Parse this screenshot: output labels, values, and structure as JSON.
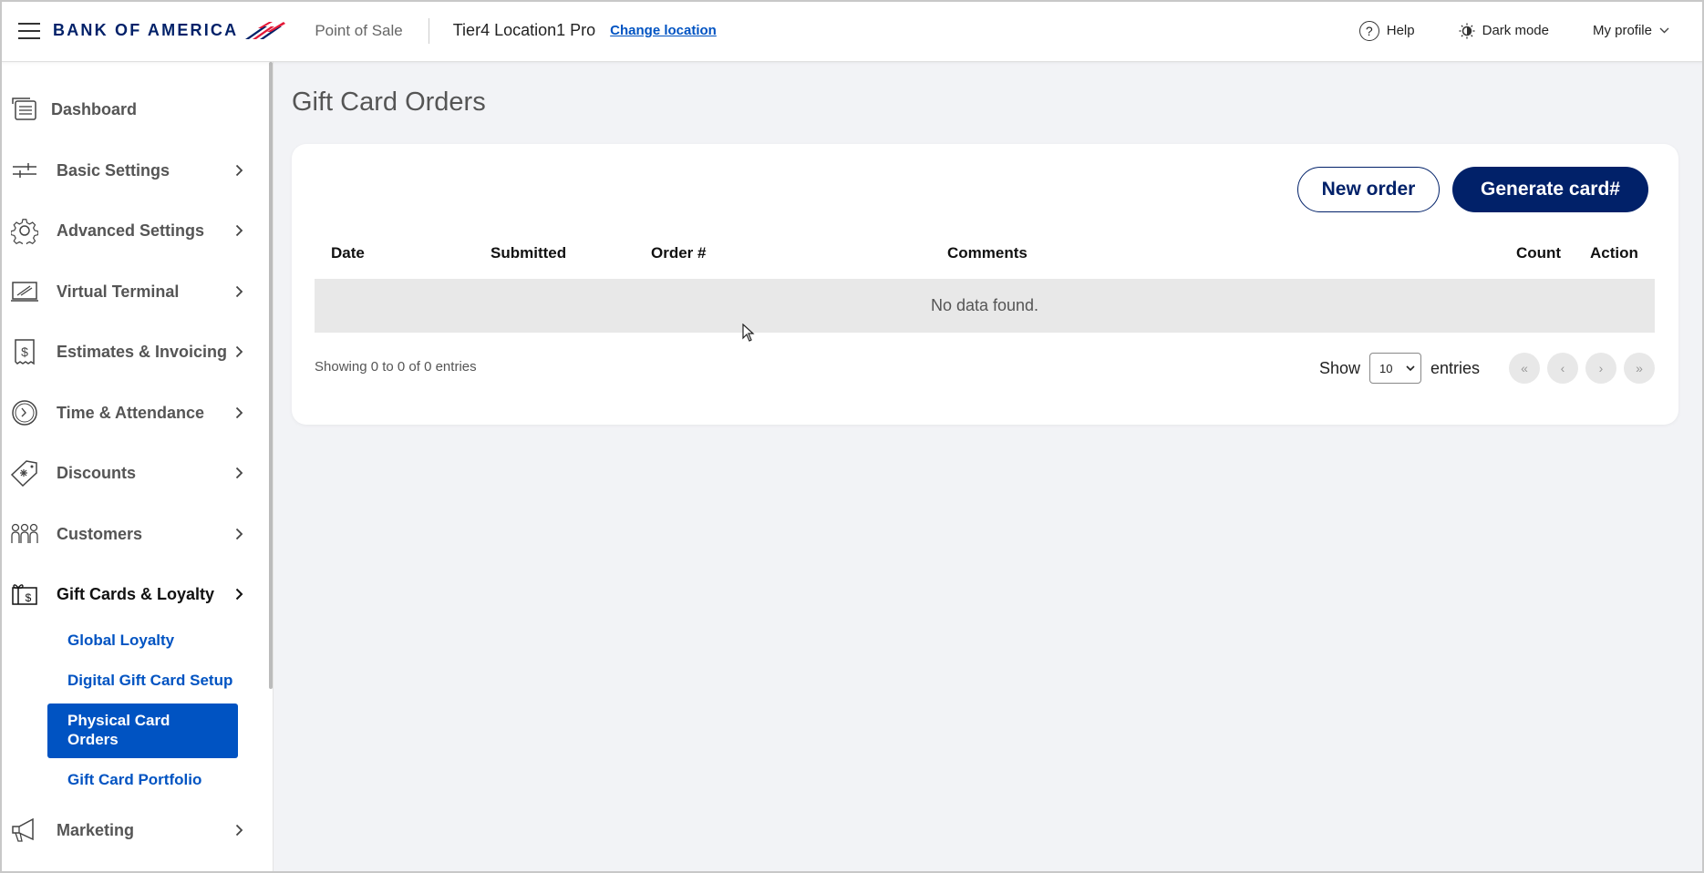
{
  "header": {
    "brand": "BANK OF AMERICA",
    "app_name": "Point of Sale",
    "location_name": "Tier4 Location1 Pro",
    "change_location": "Change location",
    "help": "Help",
    "dark_mode": "Dark mode",
    "my_profile": "My profile"
  },
  "sidebar": {
    "items": [
      {
        "label": "Dashboard",
        "icon": "dashboard-icon"
      },
      {
        "label": "Basic Settings",
        "icon": "sliders-icon"
      },
      {
        "label": "Advanced Settings",
        "icon": "gear-icon"
      },
      {
        "label": "Virtual Terminal",
        "icon": "terminal-icon"
      },
      {
        "label": "Estimates & Invoicing",
        "icon": "invoice-icon"
      },
      {
        "label": "Time & Attendance",
        "icon": "clock-icon"
      },
      {
        "label": "Discounts",
        "icon": "tag-icon"
      },
      {
        "label": "Customers",
        "icon": "people-icon"
      },
      {
        "label": "Gift Cards & Loyalty",
        "icon": "gift-card-icon"
      },
      {
        "label": "Marketing",
        "icon": "megaphone-icon"
      }
    ],
    "sub_items": [
      {
        "label": "Global Loyalty"
      },
      {
        "label": "Digital Gift Card Setup"
      },
      {
        "label": "Physical Card Orders"
      },
      {
        "label": "Gift Card Portfolio"
      }
    ]
  },
  "main": {
    "title": "Gift Card Orders",
    "new_order": "New order",
    "generate_card": "Generate card#",
    "columns": [
      "Date",
      "Submitted",
      "Order #",
      "Comments",
      "Count",
      "Action"
    ],
    "empty_message": "No data found.",
    "showing": "Showing 0 to 0 of 0 entries",
    "show_label": "Show",
    "entries_label": "entries",
    "page_size": "10",
    "pager": [
      "«",
      "‹",
      "›",
      "»"
    ]
  },
  "colors": {
    "brand_navy": "#012169",
    "link_blue": "#0053c2",
    "brand_red": "#e31837"
  }
}
